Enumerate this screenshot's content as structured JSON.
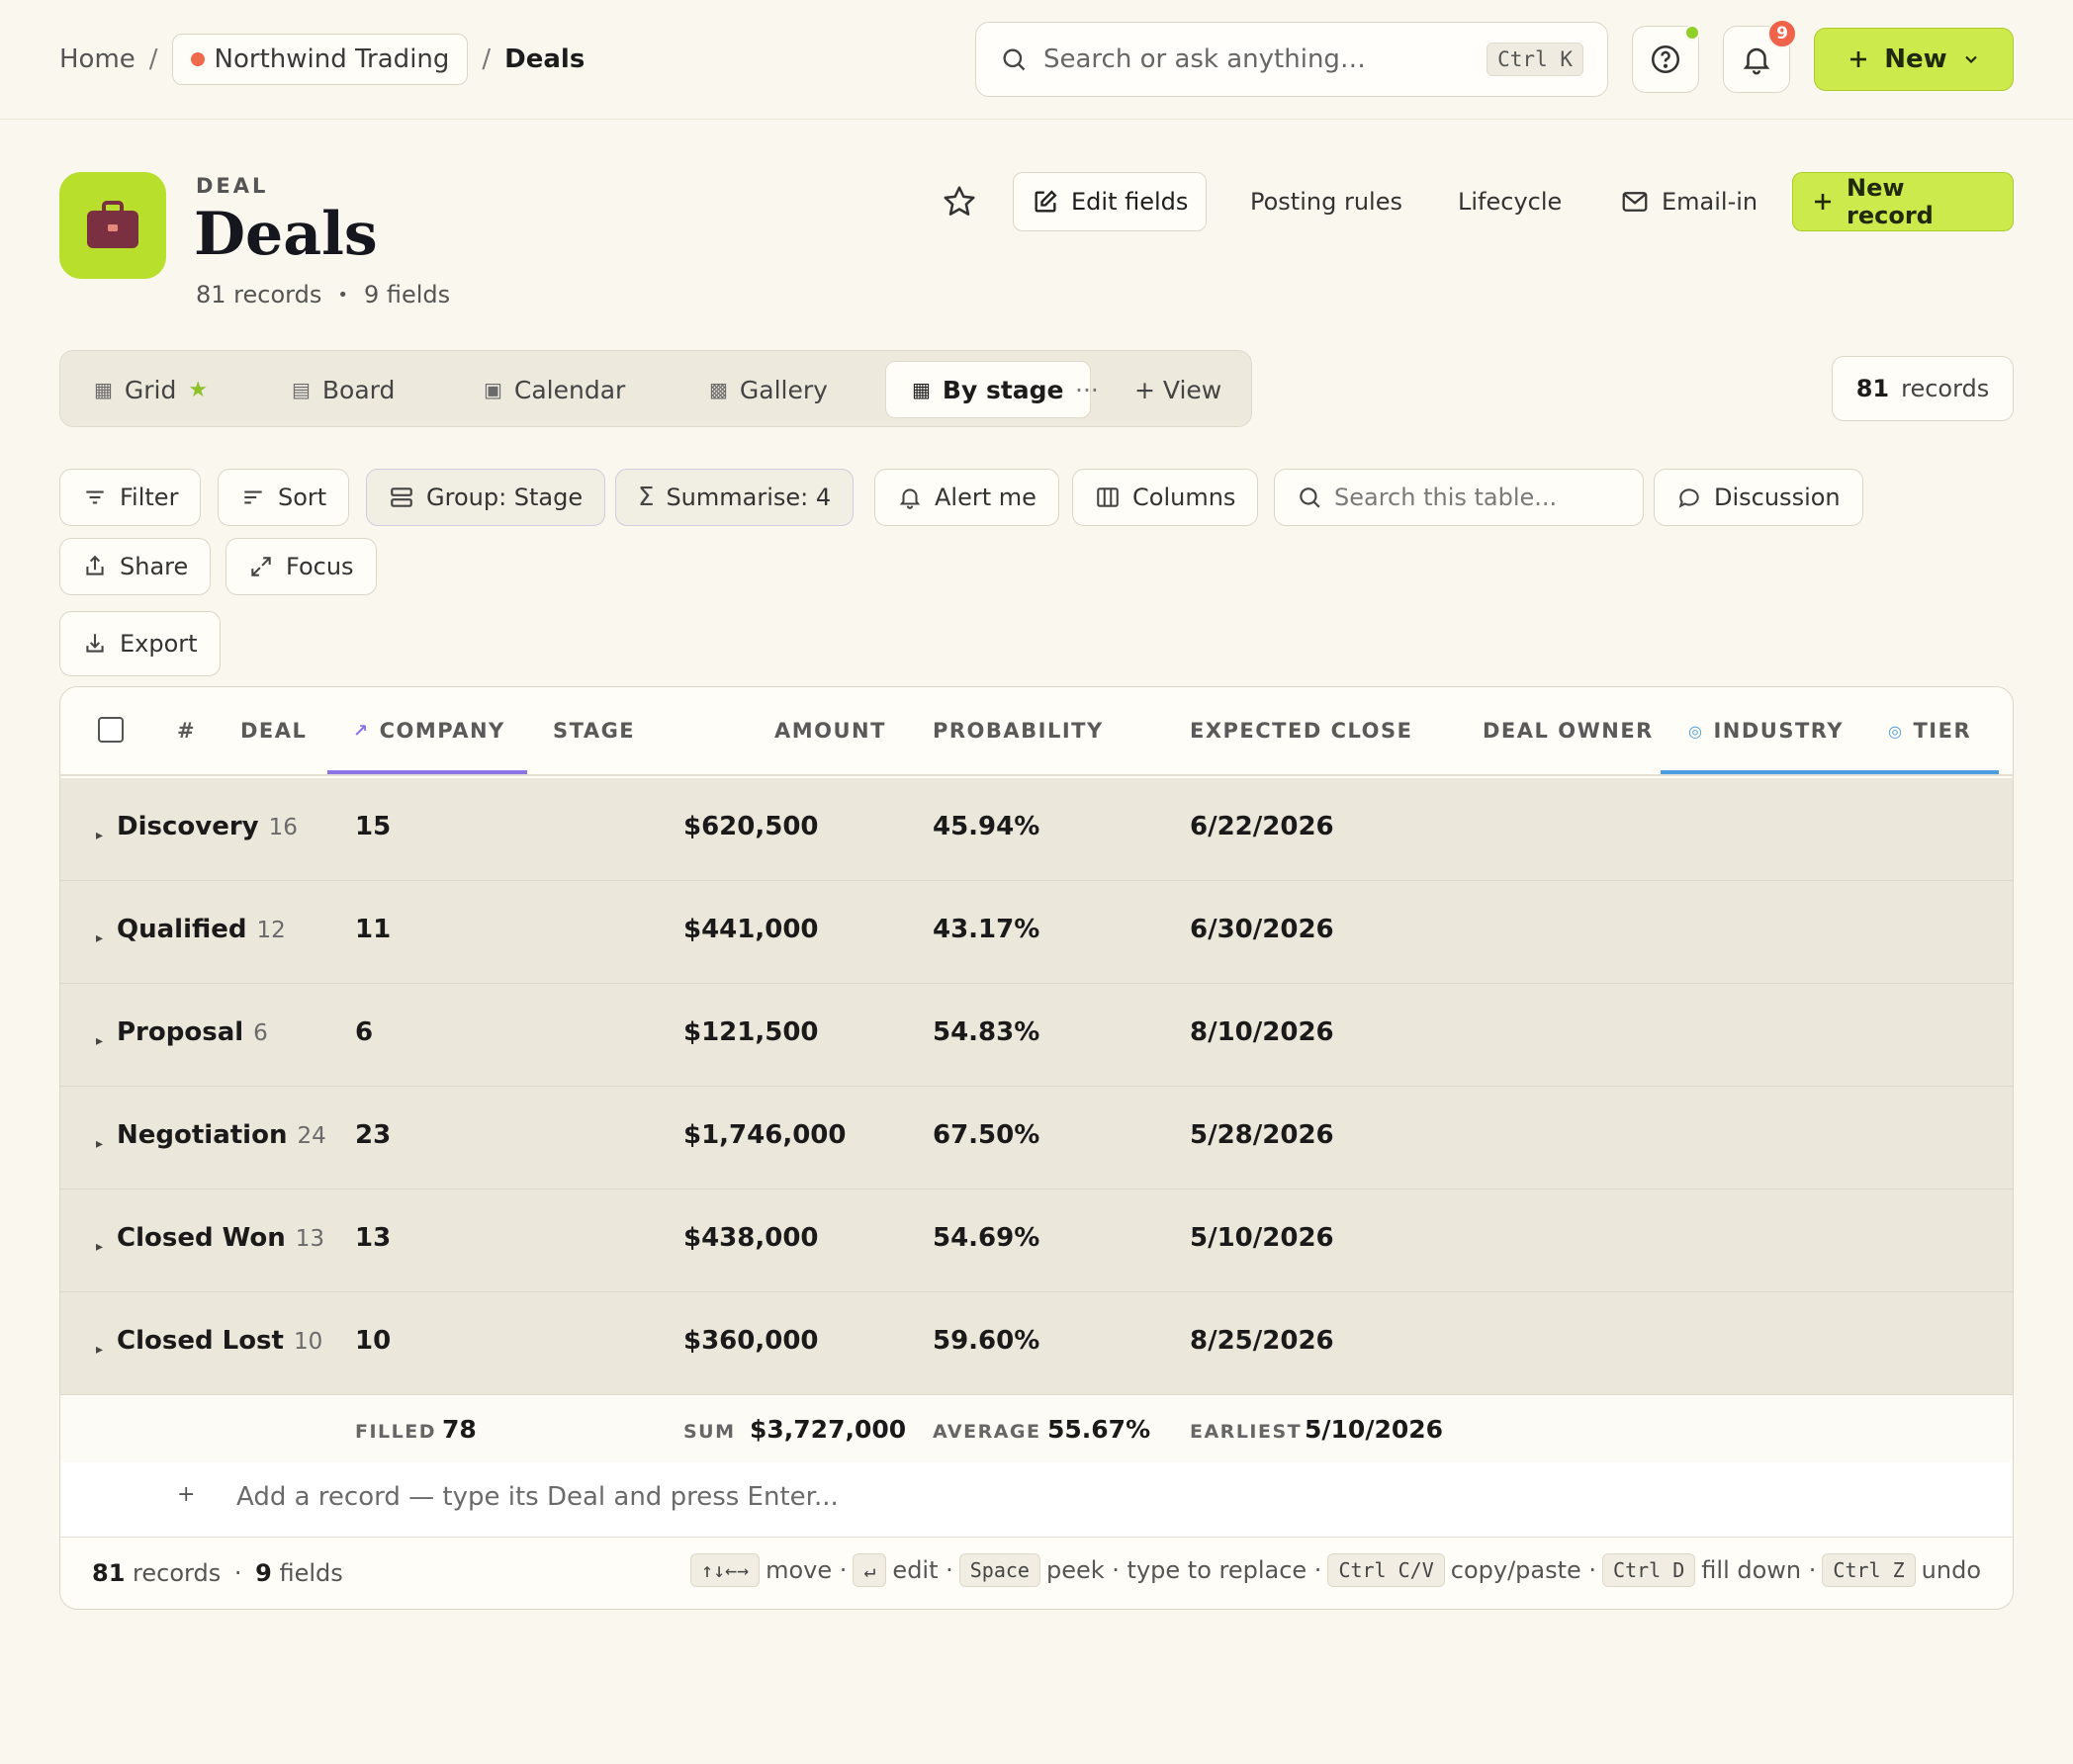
{
  "topbar": {
    "breadcrumb": {
      "home": "Home",
      "sep1": "/",
      "workspace": "Northwind Trading",
      "sep2": "/",
      "current": "Deals"
    },
    "search": {
      "placeholder": "Search or ask anything…",
      "shortcut": "Ctrl K"
    },
    "notifications_count": "9",
    "new_button": "New"
  },
  "header": {
    "overline": "DEAL",
    "title": "Deals",
    "record_count": "81 records",
    "bullet": "•",
    "field_count": "9 fields",
    "actions": {
      "edit_fields": "Edit fields",
      "posting_rules": "Posting rules",
      "lifecycle": "Lifecycle",
      "email_in": "Email-in",
      "new_record": "New record"
    }
  },
  "views": {
    "tabs": [
      "Grid",
      "Board",
      "Calendar",
      "Gallery",
      "By stage"
    ],
    "more": "···",
    "add_view": "+ View",
    "records_num": "81",
    "records_label": "records"
  },
  "toolbar": {
    "filter": "Filter",
    "sort": "Sort",
    "group": "Group: Stage",
    "summarise": "Summarise: 4",
    "alert": "Alert me",
    "columns": "Columns",
    "search_placeholder": "Search this table...",
    "discussion": "Discussion",
    "share": "Share",
    "focus": "Focus",
    "export": "Export"
  },
  "table": {
    "columns": [
      "#",
      "DEAL",
      "COMPANY",
      "STAGE",
      "AMOUNT",
      "PROBABILITY",
      "EXPECTED CLOSE",
      "DEAL OWNER",
      "INDUSTRY",
      "TIER"
    ],
    "groups": [
      {
        "name": "Discovery",
        "count": "16",
        "filled": "15",
        "amount": "$620,500",
        "probability": "45.94%",
        "close": "6/22/2026"
      },
      {
        "name": "Qualified",
        "count": "12",
        "filled": "11",
        "amount": "$441,000",
        "probability": "43.17%",
        "close": "6/30/2026"
      },
      {
        "name": "Proposal",
        "count": "6",
        "filled": "6",
        "amount": "$121,500",
        "probability": "54.83%",
        "close": "8/10/2026"
      },
      {
        "name": "Negotiation",
        "count": "24",
        "filled": "23",
        "amount": "$1,746,000",
        "probability": "67.50%",
        "close": "5/28/2026"
      },
      {
        "name": "Closed Won",
        "count": "13",
        "filled": "13",
        "amount": "$438,000",
        "probability": "54.69%",
        "close": "5/10/2026"
      },
      {
        "name": "Closed Lost",
        "count": "10",
        "filled": "10",
        "amount": "$360,000",
        "probability": "59.60%",
        "close": "8/25/2026"
      }
    ],
    "summary": {
      "filled_label": "FILLED",
      "filled_value": "78",
      "sum_label": "SUM",
      "sum_value": "$3,727,000",
      "avg_label": "AVERAGE",
      "avg_value": "55.67%",
      "earliest_label": "EARLIEST",
      "earliest_value": "5/10/2026"
    },
    "add_row": {
      "plus": "+",
      "text": "Add a record — type its Deal and press Enter..."
    },
    "footer": {
      "records_num": "81",
      "records_label": "records",
      "sep": "·",
      "fields_num": "9",
      "fields_label": "fields",
      "hints": [
        {
          "key": "↑↓←→",
          "label": "move ·"
        },
        {
          "key": "↵",
          "label": "edit ·"
        },
        {
          "key": "Space",
          "label": "peek · type to replace ·"
        },
        {
          "key": "Ctrl C/V",
          "label": "copy/paste ·"
        },
        {
          "key": "Ctrl D",
          "label": "fill down ·"
        },
        {
          "key": "Ctrl Z",
          "label": "undo"
        }
      ]
    }
  },
  "colors": {
    "accent_lime": "#cdea4d",
    "app_icon": "#b7df2c",
    "workspace_dot": "#ef6a4c",
    "notification_badge": "#f0624a",
    "sort_underline": "#8a74e8",
    "group_underline": "#4a9de0",
    "group_row_bg": "#ece7db"
  },
  "icons": [
    "search-icon",
    "help-icon",
    "bell-icon",
    "plus-icon",
    "chevron-down-icon",
    "briefcase-icon",
    "star-icon",
    "edit-icon",
    "mail-icon",
    "filter-icon",
    "sort-icon",
    "group-icon",
    "sigma-icon",
    "bell-icon",
    "columns-icon",
    "discussion-icon",
    "share-icon",
    "expand-icon",
    "download-icon"
  ]
}
